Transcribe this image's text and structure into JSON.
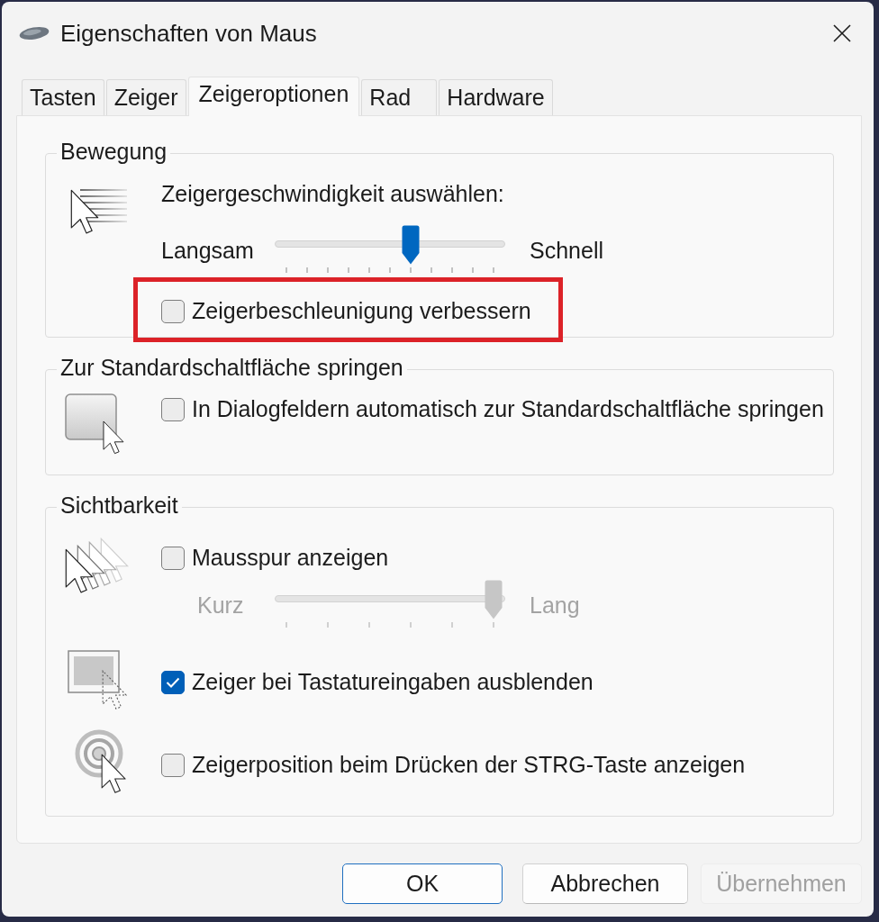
{
  "window": {
    "title": "Eigenschaften von Maus"
  },
  "tabs": [
    {
      "label": "Tasten",
      "selected": false
    },
    {
      "label": "Zeiger",
      "selected": false
    },
    {
      "label": "Zeigeroptionen",
      "selected": true
    },
    {
      "label": "Rad",
      "selected": false
    },
    {
      "label": "Hardware",
      "selected": false
    }
  ],
  "groups": [
    {
      "title": "Bewegung",
      "sections": [
        {
          "items": [
            {
              "kind": "caption",
              "text": "Zeigergeschwindigkeit auswählen:"
            },
            {
              "kind": "slider",
              "min_label": "Langsam",
              "max_label": "Schnell",
              "level": 0.6,
              "disabled": false
            },
            {
              "kind": "checkbox",
              "label": "Zeigerbeschleunigung verbessern",
              "checked": false,
              "highlighted": true
            }
          ]
        }
      ]
    },
    {
      "title": "Zur Standardschaltfläche springen",
      "sections": [
        {
          "items": [
            {
              "kind": "checkbox",
              "label": "In Dialogfeldern automatisch zur Standardschaltfläche springen",
              "checked": false,
              "highlighted": false
            }
          ]
        }
      ]
    },
    {
      "title": "Sichtbarkeit",
      "sections": [
        {
          "items": [
            {
              "kind": "checkbox",
              "label": "Mausspur anzeigen",
              "checked": false,
              "highlighted": false
            },
            {
              "kind": "slider",
              "min_label": "Kurz",
              "max_label": "Lang",
              "level": 1,
              "disabled": true
            }
          ]
        },
        {
          "items": [
            {
              "kind": "checkbox",
              "label": "Zeiger bei Tastatureingaben ausblenden",
              "checked": true,
              "highlighted": false
            }
          ]
        },
        {
          "items": [
            {
              "kind": "checkbox",
              "label": "Zeigerposition beim Drücken der STRG-Taste anzeigen",
              "checked": false,
              "highlighted": false
            }
          ]
        }
      ]
    }
  ],
  "buttons": [
    {
      "label": "OK",
      "default": true,
      "disabled": false
    },
    {
      "label": "Abbrechen",
      "default": false,
      "disabled": false
    },
    {
      "label": "Übernehmen",
      "default": false,
      "disabled": true
    }
  ]
}
